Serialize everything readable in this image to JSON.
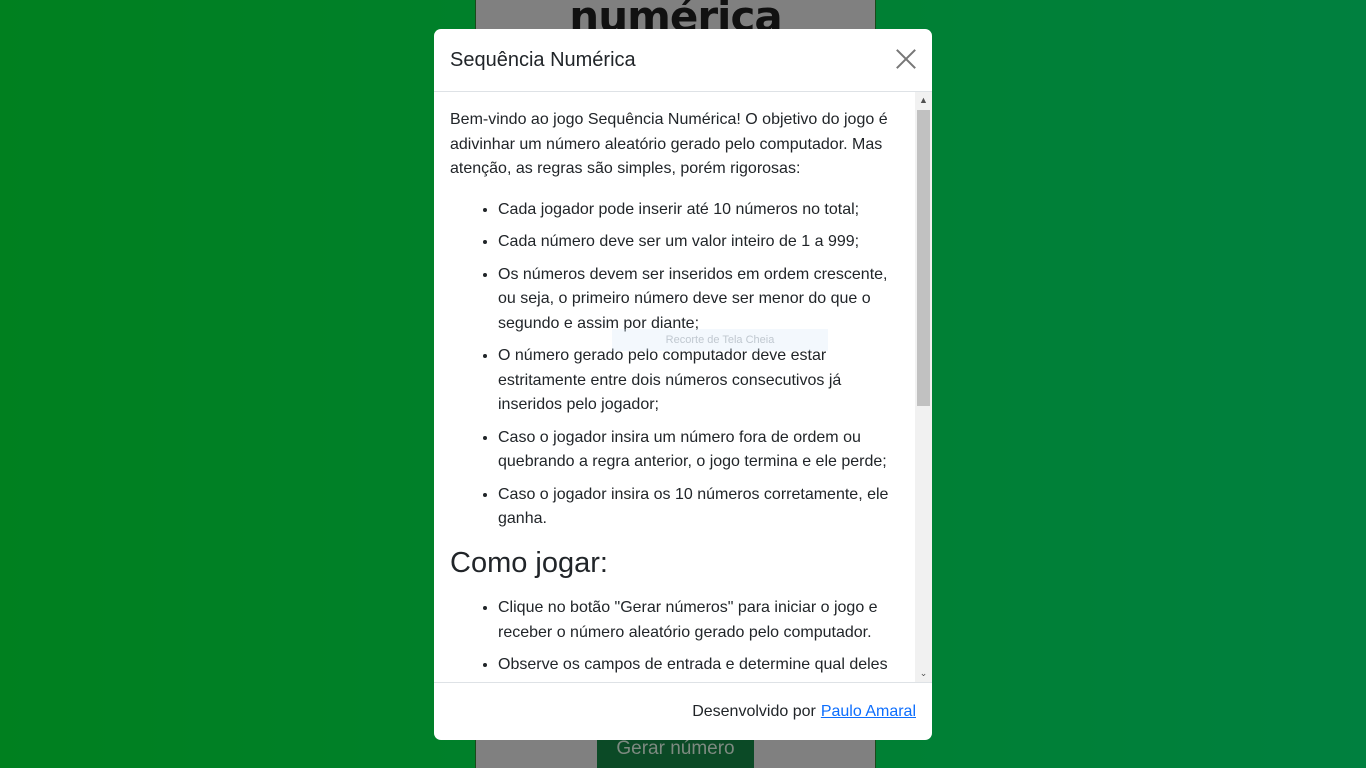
{
  "background": {
    "title": "numérica",
    "button": "Gerar número"
  },
  "modal": {
    "title": "Sequência Numérica",
    "intro": "Bem-vindo ao jogo Sequência Numérica! O objetivo do jogo é adivinhar um número aleatório gerado pelo computador. Mas atenção, as regras são simples, porém rigorosas:",
    "rules": [
      "Cada jogador pode inserir até 10 números no total;",
      "Cada número deve ser um valor inteiro de 1 a 999;",
      "Os números devem ser inseridos em ordem crescente, ou seja, o primeiro número deve ser menor do que o segundo e assim por diante;",
      "O número gerado pelo computador deve estar estritamente entre dois números consecutivos já inseridos pelo jogador;",
      "Caso o jogador insira um número fora de ordem ou quebrando a regra anterior, o jogo termina e ele perde;",
      "Caso o jogador insira os 10 números corretamente, ele ganha."
    ],
    "how_to_title": "Como jogar:",
    "how_to": [
      "Clique no botão \"Gerar números\" para iniciar o jogo e receber o número aleatório gerado pelo computador.",
      "Observe os campos de entrada e determine qual deles deve ser preenchido com o número adequado."
    ],
    "footer_text": "Desenvolvido por",
    "footer_link": "Paulo Amaral"
  },
  "watermark": "Recorte de Tela Cheia"
}
